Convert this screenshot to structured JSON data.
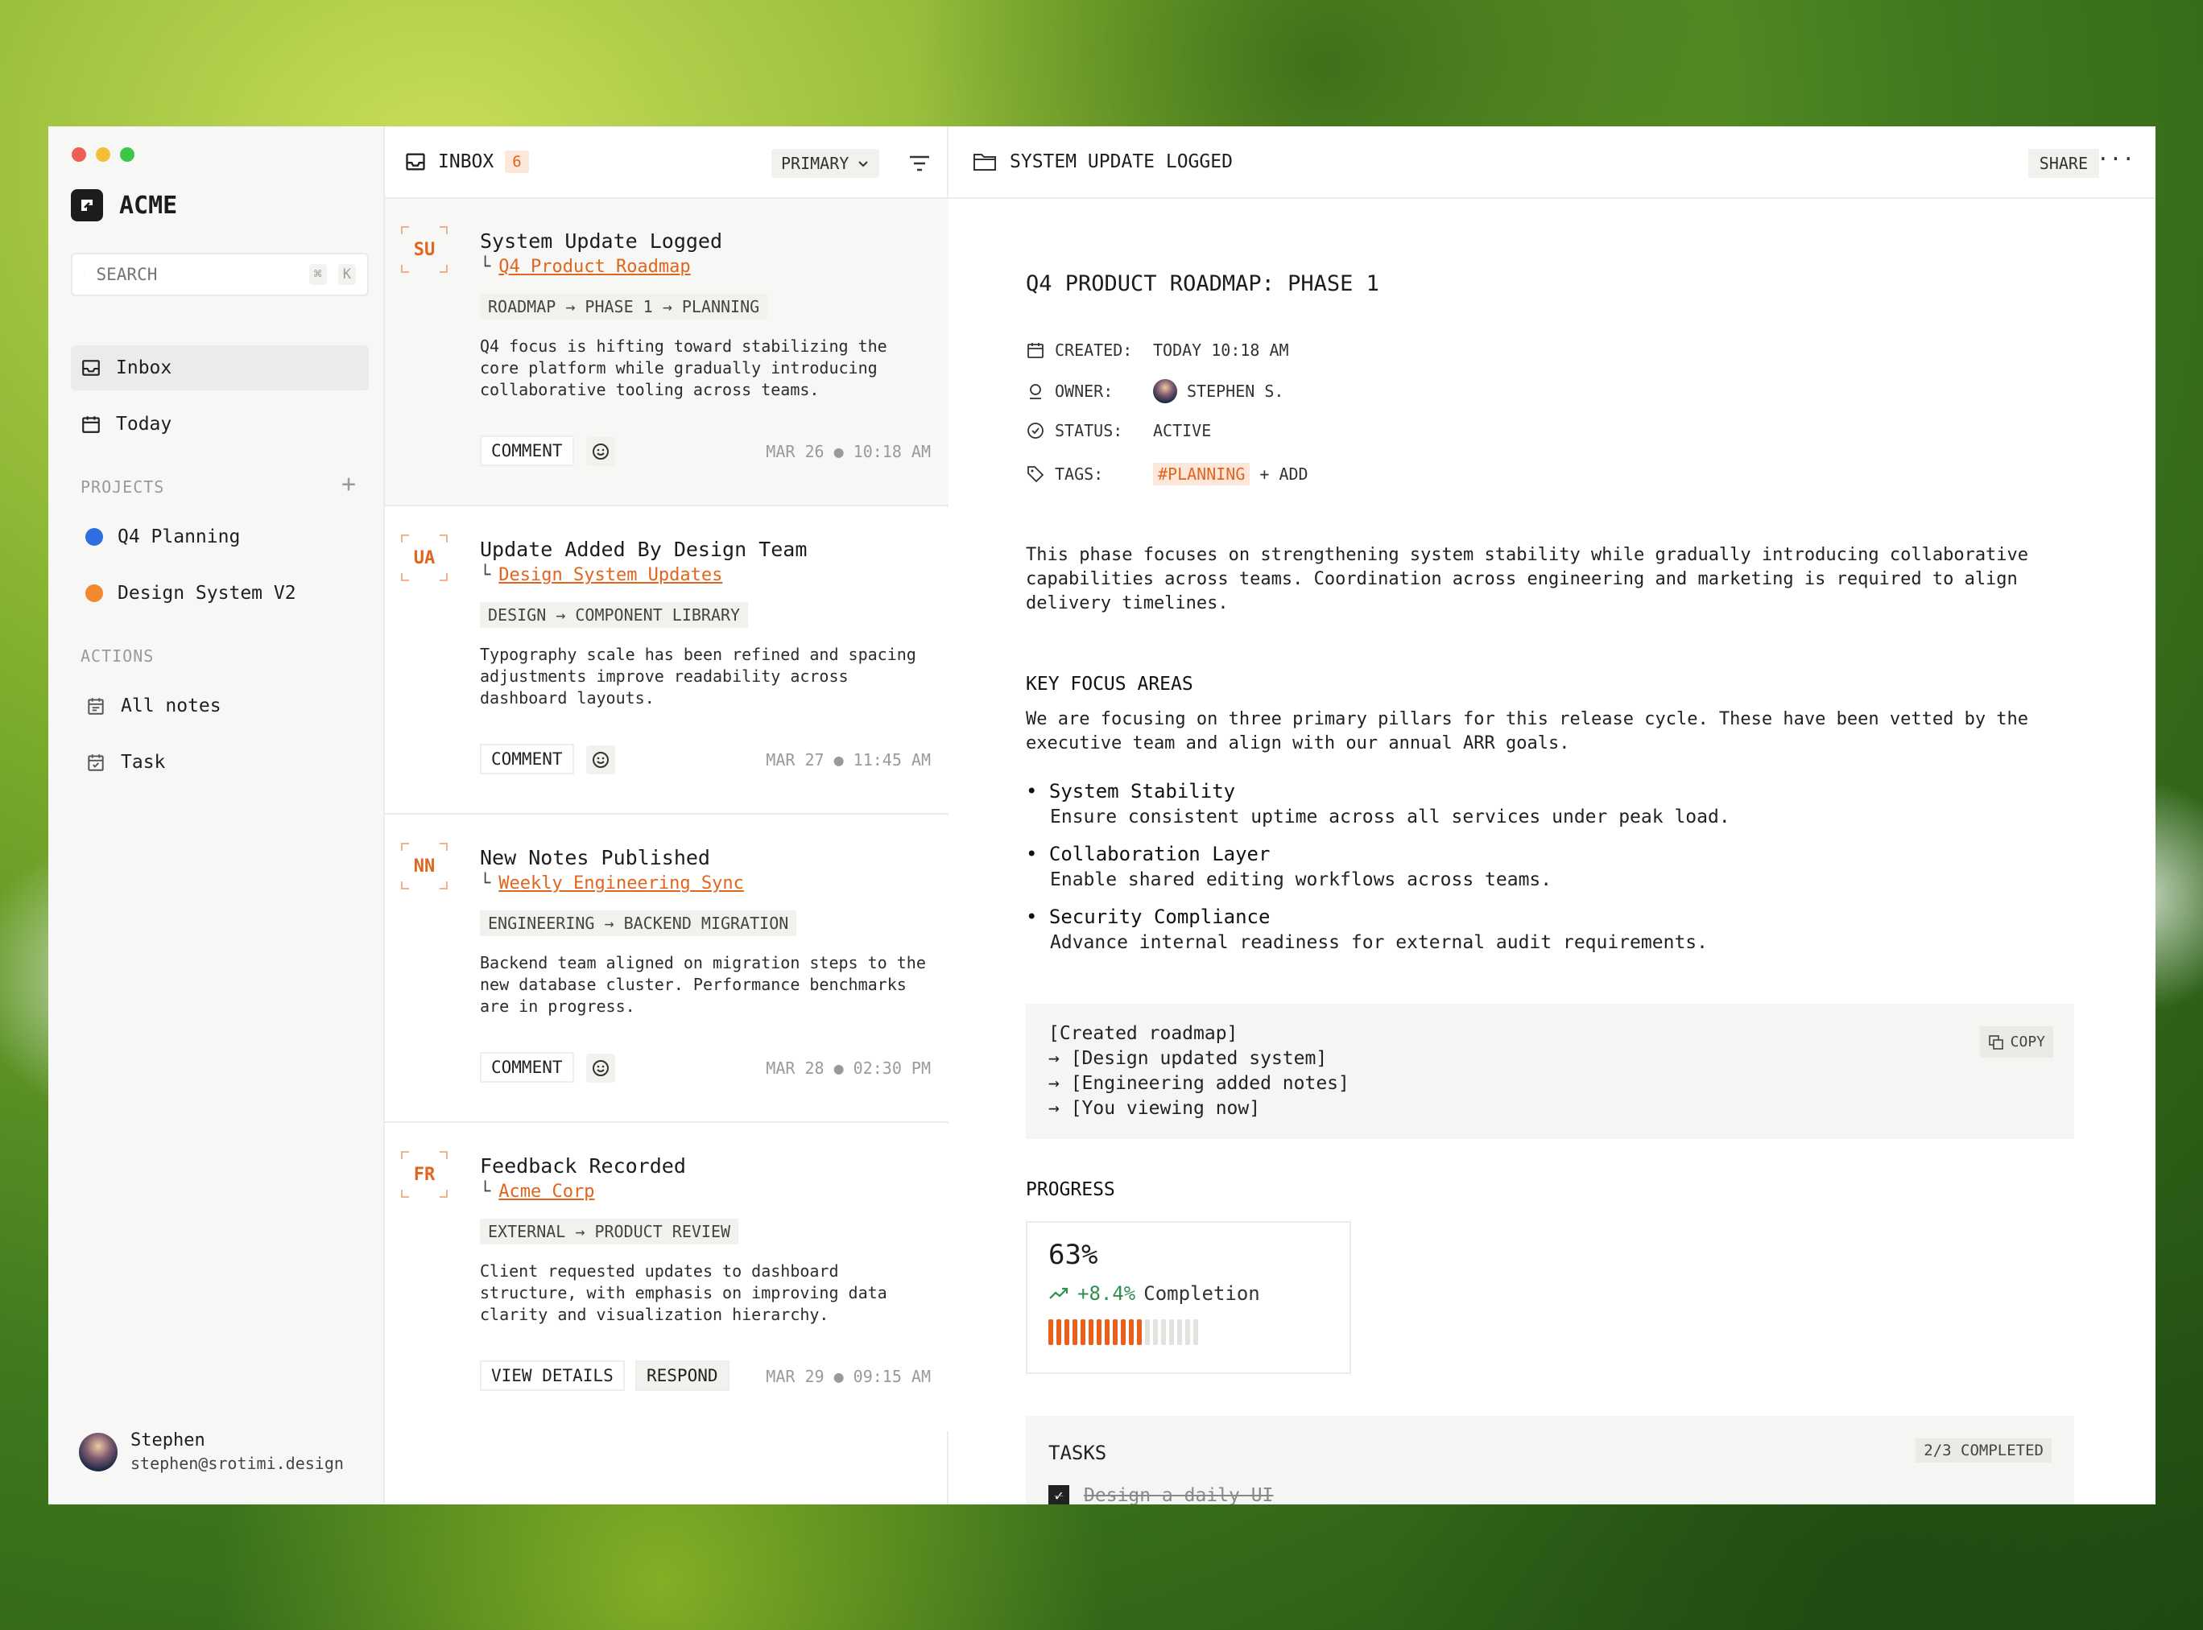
{
  "app": {
    "brand": "ACME",
    "traffic_lights": {
      "close": "#f05f57",
      "min": "#f5be3a",
      "max": "#3dc748"
    }
  },
  "search": {
    "placeholder": "SEARCH",
    "shortcut_cmd": "⌘",
    "shortcut_key": "K"
  },
  "sidebar": {
    "nav": [
      {
        "label": "Inbox",
        "icon": "inbox-icon"
      },
      {
        "label": "Today",
        "icon": "calendar-icon"
      }
    ],
    "projects_header": "PROJECTS",
    "projects": [
      {
        "label": "Q4 Planning",
        "color": "#2f6de1"
      },
      {
        "label": "Design System V2",
        "color": "#f0892f"
      }
    ],
    "actions_header": "ACTIONS",
    "actions": [
      {
        "label": "All notes",
        "icon": "notes-icon"
      },
      {
        "label": "Task",
        "icon": "task-icon"
      }
    ],
    "user": {
      "name": "Stephen",
      "email": "stephen@srotimi.design"
    }
  },
  "list": {
    "title": "INBOX",
    "count": "6",
    "filter": "PRIMARY",
    "items": [
      {
        "initials": "SU",
        "title": "System Update Logged",
        "link": "Q4 Product Roadmap",
        "crumb": "ROADMAP → PHASE 1 → PLANNING",
        "body": "Q4 focus is hifting toward stabilizing the core platform while gradually introducing collaborative tooling across teams.",
        "btn1": "COMMENT",
        "date": "MAR 26",
        "time": "10:18 AM"
      },
      {
        "initials": "UA",
        "title": "Update Added By Design Team",
        "link": "Design System Updates",
        "crumb": "DESIGN → COMPONENT LIBRARY",
        "body": "Typography scale has been refined and spacing adjustments improve readability across dashboard layouts.",
        "btn1": "COMMENT",
        "date": "MAR 27",
        "time": "11:45 AM"
      },
      {
        "initials": "NN",
        "title": "New Notes Published",
        "link": "Weekly Engineering Sync",
        "crumb": "ENGINEERING → BACKEND MIGRATION",
        "body": "Backend team aligned on migration steps to the new database cluster. Performance benchmarks are in progress.",
        "btn1": "COMMENT",
        "date": "MAR 28",
        "time": "02:30 PM"
      },
      {
        "initials": "FR",
        "title": "Feedback Recorded",
        "link": "Acme Corp",
        "crumb": "EXTERNAL → PRODUCT REVIEW",
        "body": "Client requested updates to dashboard structure, with emphasis on improving data clarity and visualization hierarchy.",
        "btn1": "VIEW DETAILS",
        "btn2": "RESPOND",
        "date": "MAR 29",
        "time": "09:15 AM"
      }
    ]
  },
  "detail": {
    "header": "SYSTEM UPDATE LOGGED",
    "share": "SHARE",
    "title": "Q4 PRODUCT ROADMAP: PHASE 1",
    "meta": {
      "created_k": "CREATED:",
      "created_v": "TODAY 10:18 AM",
      "owner_k": "OWNER:",
      "owner_v": "STEPHEN S.",
      "status_k": "STATUS:",
      "status_v": "ACTIVE",
      "tags_k": "TAGS:",
      "tag": "#PLANNING",
      "add": "ADD"
    },
    "intro": "This phase focuses on strengthening system stability while gradually introducing collaborative capabilities across teams. Coordination across engineering and marketing is required to align delivery timelines.",
    "focus_h": "KEY FOCUS AREAS",
    "focus_p": "We are focusing on three primary pillars for this release cycle. These have been vetted by the executive team and align with our annual ARR goals.",
    "pillars": [
      {
        "t": "System Stability",
        "s": "Ensure consistent uptime across all services under peak load."
      },
      {
        "t": "Collaboration Layer",
        "s": "Enable shared editing workflows across teams."
      },
      {
        "t": "Security Compliance",
        "s": "Advance internal readiness for external audit requirements."
      }
    ],
    "code": [
      "[Created roadmap]",
      "→ [Design updated system]",
      "→ [Engineering added notes]",
      "→ [You viewing now]"
    ],
    "copy": "COPY",
    "progress_h": "PROGRESS",
    "progress_pct": "63%",
    "progress_delta": "+8.4%",
    "progress_label": "Completion",
    "progress_fraction": 0.63,
    "tasks_h": "TASKS",
    "tasks_count": "2/3 COMPLETED",
    "task1": "Design a daily UI"
  }
}
